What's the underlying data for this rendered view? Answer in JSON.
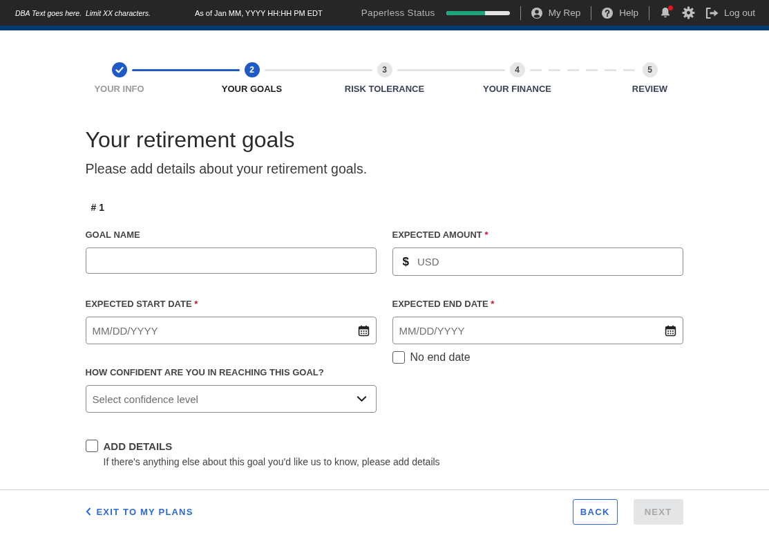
{
  "top_bar": {
    "dba_text": "DBA Text goes here.  Limit XX characters.",
    "as_of": "As of Jan MM, YYYY HH:HH PM EDT",
    "paperless_status": {
      "label": "Paperless Status",
      "level": 0.61
    },
    "links": [
      {
        "kind": "rep",
        "label": "My Rep"
      },
      {
        "kind": "help",
        "label": "Help"
      }
    ],
    "notifications": {
      "unread": true
    },
    "logout": {
      "label": "Log out"
    }
  },
  "stepper": [
    {
      "label": "YOUR INFO",
      "completed": true,
      "selected": false,
      "connector": {
        "dashed": false
      }
    },
    {
      "number": "2",
      "label": "YOUR GOALS",
      "completed": false,
      "selected": true,
      "connector": {
        "dashed": false
      }
    },
    {
      "number": "3",
      "label": "RISK TOLERANCE",
      "completed": false,
      "selected": false,
      "connector": {
        "dashed": false
      }
    },
    {
      "number": "4",
      "label": "YOUR FINANCE",
      "completed": false,
      "selected": false,
      "connector": {
        "dashed": true
      }
    },
    {
      "number": "5",
      "label": "REVIEW",
      "completed": false,
      "selected": false
    }
  ],
  "page": {
    "title": "Your retirement goals",
    "subtitle": "Please add details about your retirement goals."
  },
  "goal": {
    "number": "# 1",
    "fields": [
      {
        "kind": "text",
        "label": "GOAL NAME"
      },
      {
        "kind": "currency",
        "label": "EXPECTED AMOUNT",
        "required_mark": "*",
        "prefix": "$",
        "placeholder": "USD"
      },
      {
        "kind": "date",
        "label": "EXPECTED START DATE",
        "required_mark": "*",
        "placeholder": "MM/DD/YYYY"
      },
      {
        "kind": "date",
        "label": "EXPECTED END DATE",
        "required_mark": "*",
        "placeholder": "MM/DD/YYYY",
        "option": {
          "label": "No end date",
          "checked": false
        }
      },
      {
        "kind": "select",
        "label": "HOW CONFIDENT ARE YOU IN REACHING THIS GOAL?",
        "placeholder": "Select confidence level"
      }
    ],
    "add_details": {
      "label": "ADD DETAILS",
      "checked": false,
      "helper": "If there's anything else about this goal you'd like us to know, please add details"
    }
  },
  "footer": {
    "exit_link": "EXIT TO MY PLANS",
    "buttons": [
      {
        "label": "BACK",
        "kind": "secondary",
        "disabled": false
      },
      {
        "label": "NEXT",
        "kind": "primary",
        "disabled": true
      }
    ]
  }
}
